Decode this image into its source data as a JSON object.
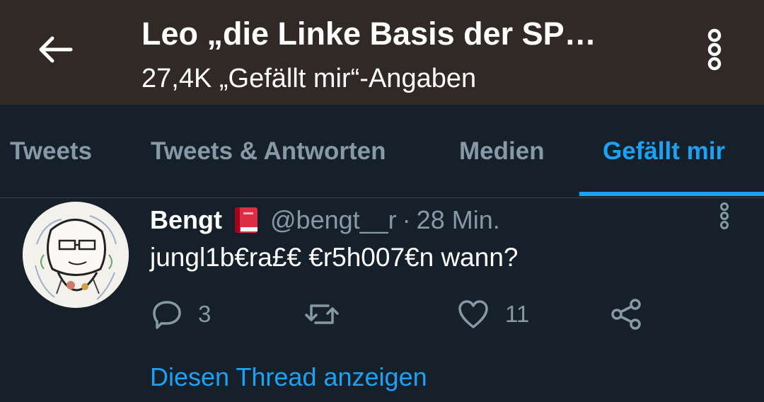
{
  "header": {
    "back_icon": "arrow-left-icon",
    "title": "Leo „die Linke Basis der SP…",
    "subtitle": "27,4K „Gefällt mir“-Angaben",
    "more_icon": "more-vertical-icon"
  },
  "tabs": [
    {
      "label": "Tweets",
      "active": false
    },
    {
      "label": "Tweets & Antworten",
      "active": false
    },
    {
      "label": "Medien",
      "active": false
    },
    {
      "label": "Gefällt mir",
      "active": true
    }
  ],
  "tweet": {
    "author_name": "Bengt",
    "author_emoji": "closed-book-icon",
    "handle": "@bengt__r",
    "separator": "·",
    "time": "28 Min.",
    "text": "jungl1b€ra£€ €r5h007€n wann?",
    "actions": {
      "reply_count": "3",
      "retweet_count": "",
      "like_count": "11"
    },
    "show_thread": "Diesen Thread anzeigen"
  },
  "colors": {
    "header_bg": "#302925",
    "body_bg": "#15202b",
    "accent": "#1da1f2",
    "muted": "#8899a6"
  }
}
